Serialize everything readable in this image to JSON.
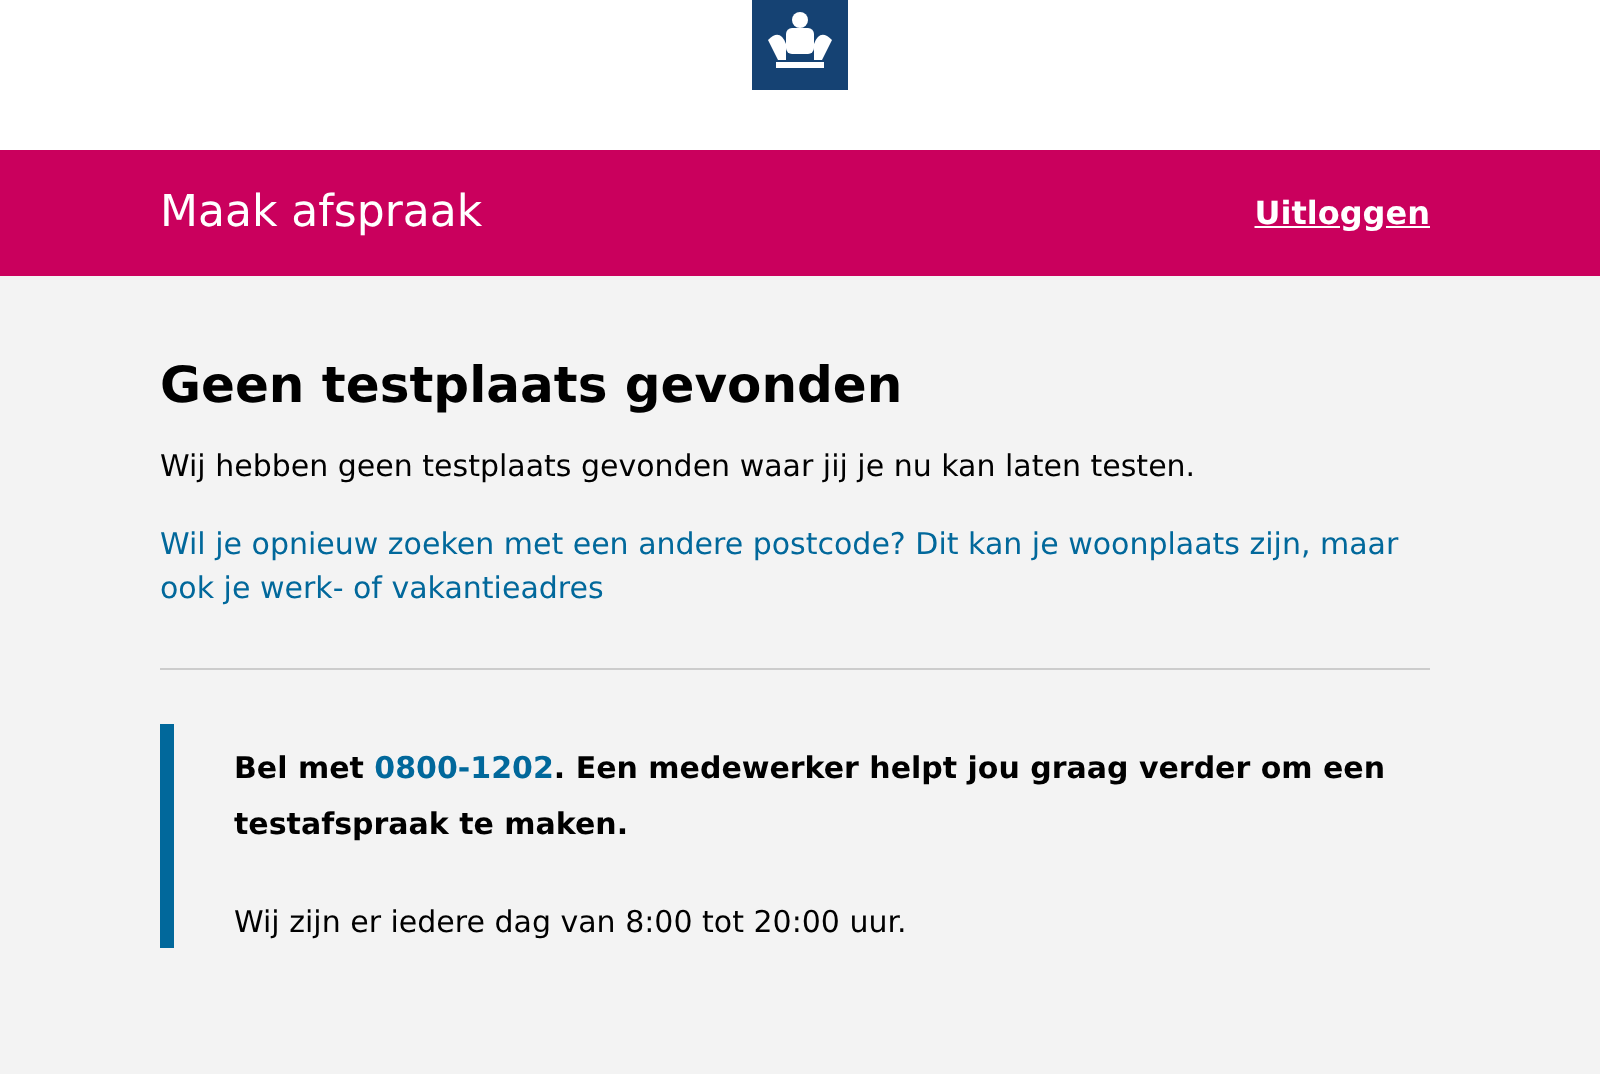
{
  "header": {
    "title": "Maak afspraak",
    "logout": "Uitloggen"
  },
  "main": {
    "heading": "Geen testplaats gevonden",
    "intro": "Wij hebben geen testplaats gevonden waar jij je nu kan laten testen.",
    "search_again_link": "Wil je opnieuw zoeken met een andere postcode? Dit kan je woonplaats zijn, maar ook je werk- of vakantieadres"
  },
  "notice": {
    "call_prefix": "Bel met",
    "phone": "0800-1202",
    "call_suffix": ". Een medewerker helpt jou graag verder om een testafspraak te maken.",
    "hours": "Wij zijn er iedere dag van 8:00 tot 20:00 uur."
  }
}
